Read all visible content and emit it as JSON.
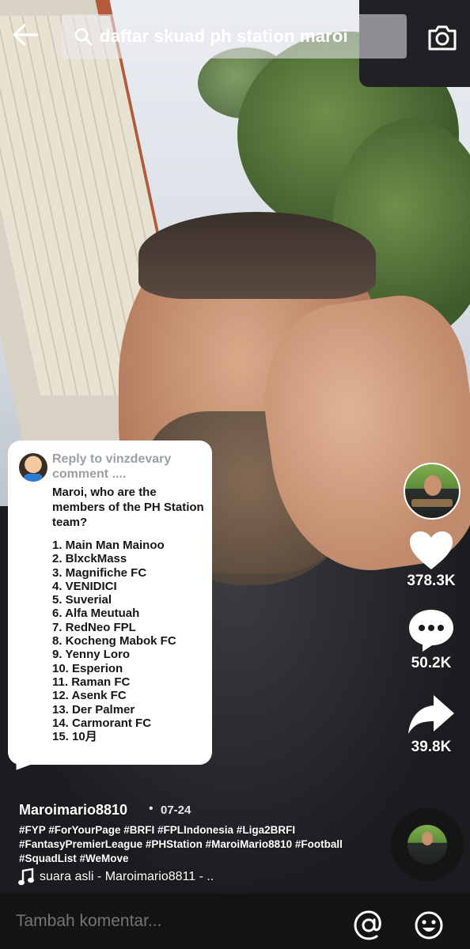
{
  "search": {
    "query": "daftar skuad ph station maroi"
  },
  "reply": {
    "title": "Reply to vinzdevary comment ....",
    "question": "Maroi, who are the members of the PH Station team?",
    "teams": [
      "1. Main Man Mainoo",
      "2. BlxckMass",
      "3. Magnifiche FC",
      "4. VENIDICI",
      "5. Suverial",
      "6. Alfa Meutuah",
      "7. RedNeo FPL",
      "8. Kocheng Mabok FC",
      "9. Yenny Loro",
      "10. Esperion",
      "11. Raman FC",
      "12. Asenk FC",
      "13. Der Palmer",
      "14. Carmorant FC",
      "15. 10月"
    ]
  },
  "actions": {
    "likes": "378.3K",
    "comments": "50.2K",
    "shares": "39.8K"
  },
  "post": {
    "username": "Maroimario8810",
    "separator": "•",
    "date": "07-24",
    "hashtags": "#FYP #ForYourPage #BRFI #FPLIndonesia #Liga2BRFI #FantasyPremierLeague #PHStation #MaroiMario8810 #Football #SquadList #WeMove",
    "sound": "suara asli - Maroimario8811 - .."
  },
  "comment_bar": {
    "placeholder": "Tambah komentar..."
  },
  "icons": [
    "back-arrow-icon",
    "search-icon",
    "camera-icon",
    "heart-icon",
    "comment-bubble-icon",
    "share-arrow-icon",
    "music-note-icon",
    "at-mention-icon",
    "emoji-icon"
  ],
  "colors": {
    "bubble_bg": "#ffffff",
    "reply_title": "#9aa0a6",
    "comment_bar_bg": "#141414"
  }
}
